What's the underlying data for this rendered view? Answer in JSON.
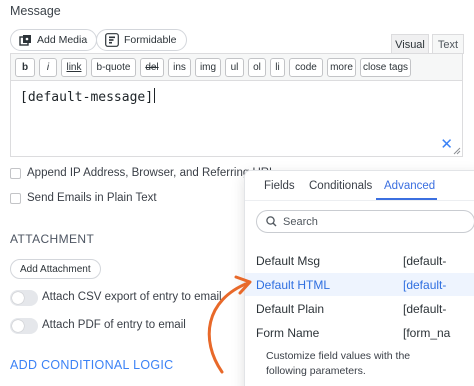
{
  "field_label": "Message",
  "media": {
    "add_media": "Add Media",
    "formidable": "Formidable"
  },
  "editor_tabs": {
    "visual": "Visual",
    "text": "Text"
  },
  "toolbar": [
    "b",
    "i",
    "link",
    "b-quote",
    "del",
    "ins",
    "img",
    "ul",
    "ol",
    "li",
    "code",
    "more",
    "close tags"
  ],
  "editor_content": "[default-message]",
  "checkboxes": {
    "append_ip": "Append IP Address, Browser, and Referring URL",
    "plain_text": "Send Emails in Plain Text"
  },
  "attachment": {
    "title": "ATTACHMENT",
    "add_button": "Add Attachment",
    "csv_label": "Attach CSV export of entry to email",
    "pdf_label": "Attach PDF of entry to email"
  },
  "conditional_logic": "ADD CONDITIONAL LOGIC",
  "popup": {
    "tabs": [
      "Fields",
      "Conditionals",
      "Advanced"
    ],
    "active_tab": "Advanced",
    "search_placeholder": "Search",
    "rows": [
      {
        "key": "Default Msg",
        "value": "[default-"
      },
      {
        "key": "Default HTML",
        "value": "[default-"
      },
      {
        "key": "Default Plain",
        "value": "[default-"
      },
      {
        "key": "Form Name",
        "value": "[form_na"
      }
    ],
    "highlighted_row": "Default HTML",
    "footer": "Customize field values with the following parameters."
  },
  "colors": {
    "accent": "#3b6fe0",
    "highlight": "#eef4fe",
    "arrow": "#e8692a",
    "toggle_off": "#e5e7eb"
  },
  "icons": [
    "add-media-icon",
    "formidable-icon",
    "clear-x-icon",
    "resize-handle-icon",
    "search-icon",
    "annotation-arrow"
  ]
}
